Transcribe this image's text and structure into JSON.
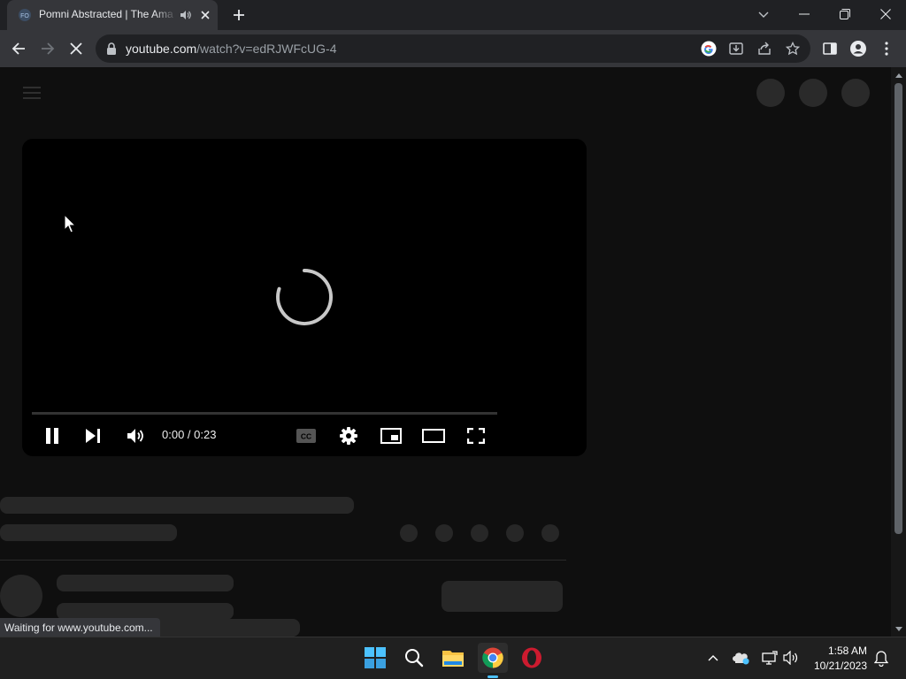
{
  "browser": {
    "tab": {
      "title": "Pomni Abstracted | The Amazing Digital Circus",
      "favicon_text": "FO",
      "audio_icon": "speaker-icon",
      "close_icon": "close-icon"
    },
    "new_tab_icon": "plus-icon",
    "tab_search_icon": "chevron-down-icon",
    "window_controls": [
      "minimize-icon",
      "restore-icon",
      "close-icon"
    ],
    "toolbar": {
      "url_domain": "youtube.com",
      "url_path": "/watch?v=edRJWFcUG-4",
      "nav_icons": [
        "back-arrow-icon",
        "forward-arrow-icon",
        "stop-loading-icon"
      ],
      "omnibox_icons": [
        "lock-icon",
        "google-icon",
        "install-app-icon",
        "share-icon",
        "star-icon"
      ],
      "right_icons": [
        "side-panel-icon",
        "profile-icon",
        "kebab-menu-icon"
      ]
    },
    "status_text": "Waiting for www.youtube.com..."
  },
  "player": {
    "time_display": "0:00 / 0:23",
    "state": "loading",
    "progress": 0,
    "controls": [
      "pause-icon",
      "next-icon",
      "volume-icon",
      "captions-icon",
      "settings-icon",
      "miniplayer-icon",
      "theater-mode-icon",
      "fullscreen-icon"
    ]
  },
  "taskbar": {
    "pinned": [
      "windows-start-icon",
      "search-icon",
      "file-explorer-icon",
      "chrome-icon",
      "opera-icon"
    ],
    "active_app": "chrome-icon",
    "tray": [
      "chevron-up-icon",
      "onedrive-icon",
      "network-icon",
      "volume-icon"
    ],
    "clock_time": "1:58 AM",
    "clock_date": "10/21/2023",
    "notification_icon": "bell-icon"
  },
  "colors": {
    "page_background": "#0f0f0f",
    "skeleton": "#272727",
    "chrome_toolbar": "#35363a",
    "chrome_tabstrip": "#202124",
    "taskbar": "#202020",
    "accent": "#4cc2ff"
  }
}
